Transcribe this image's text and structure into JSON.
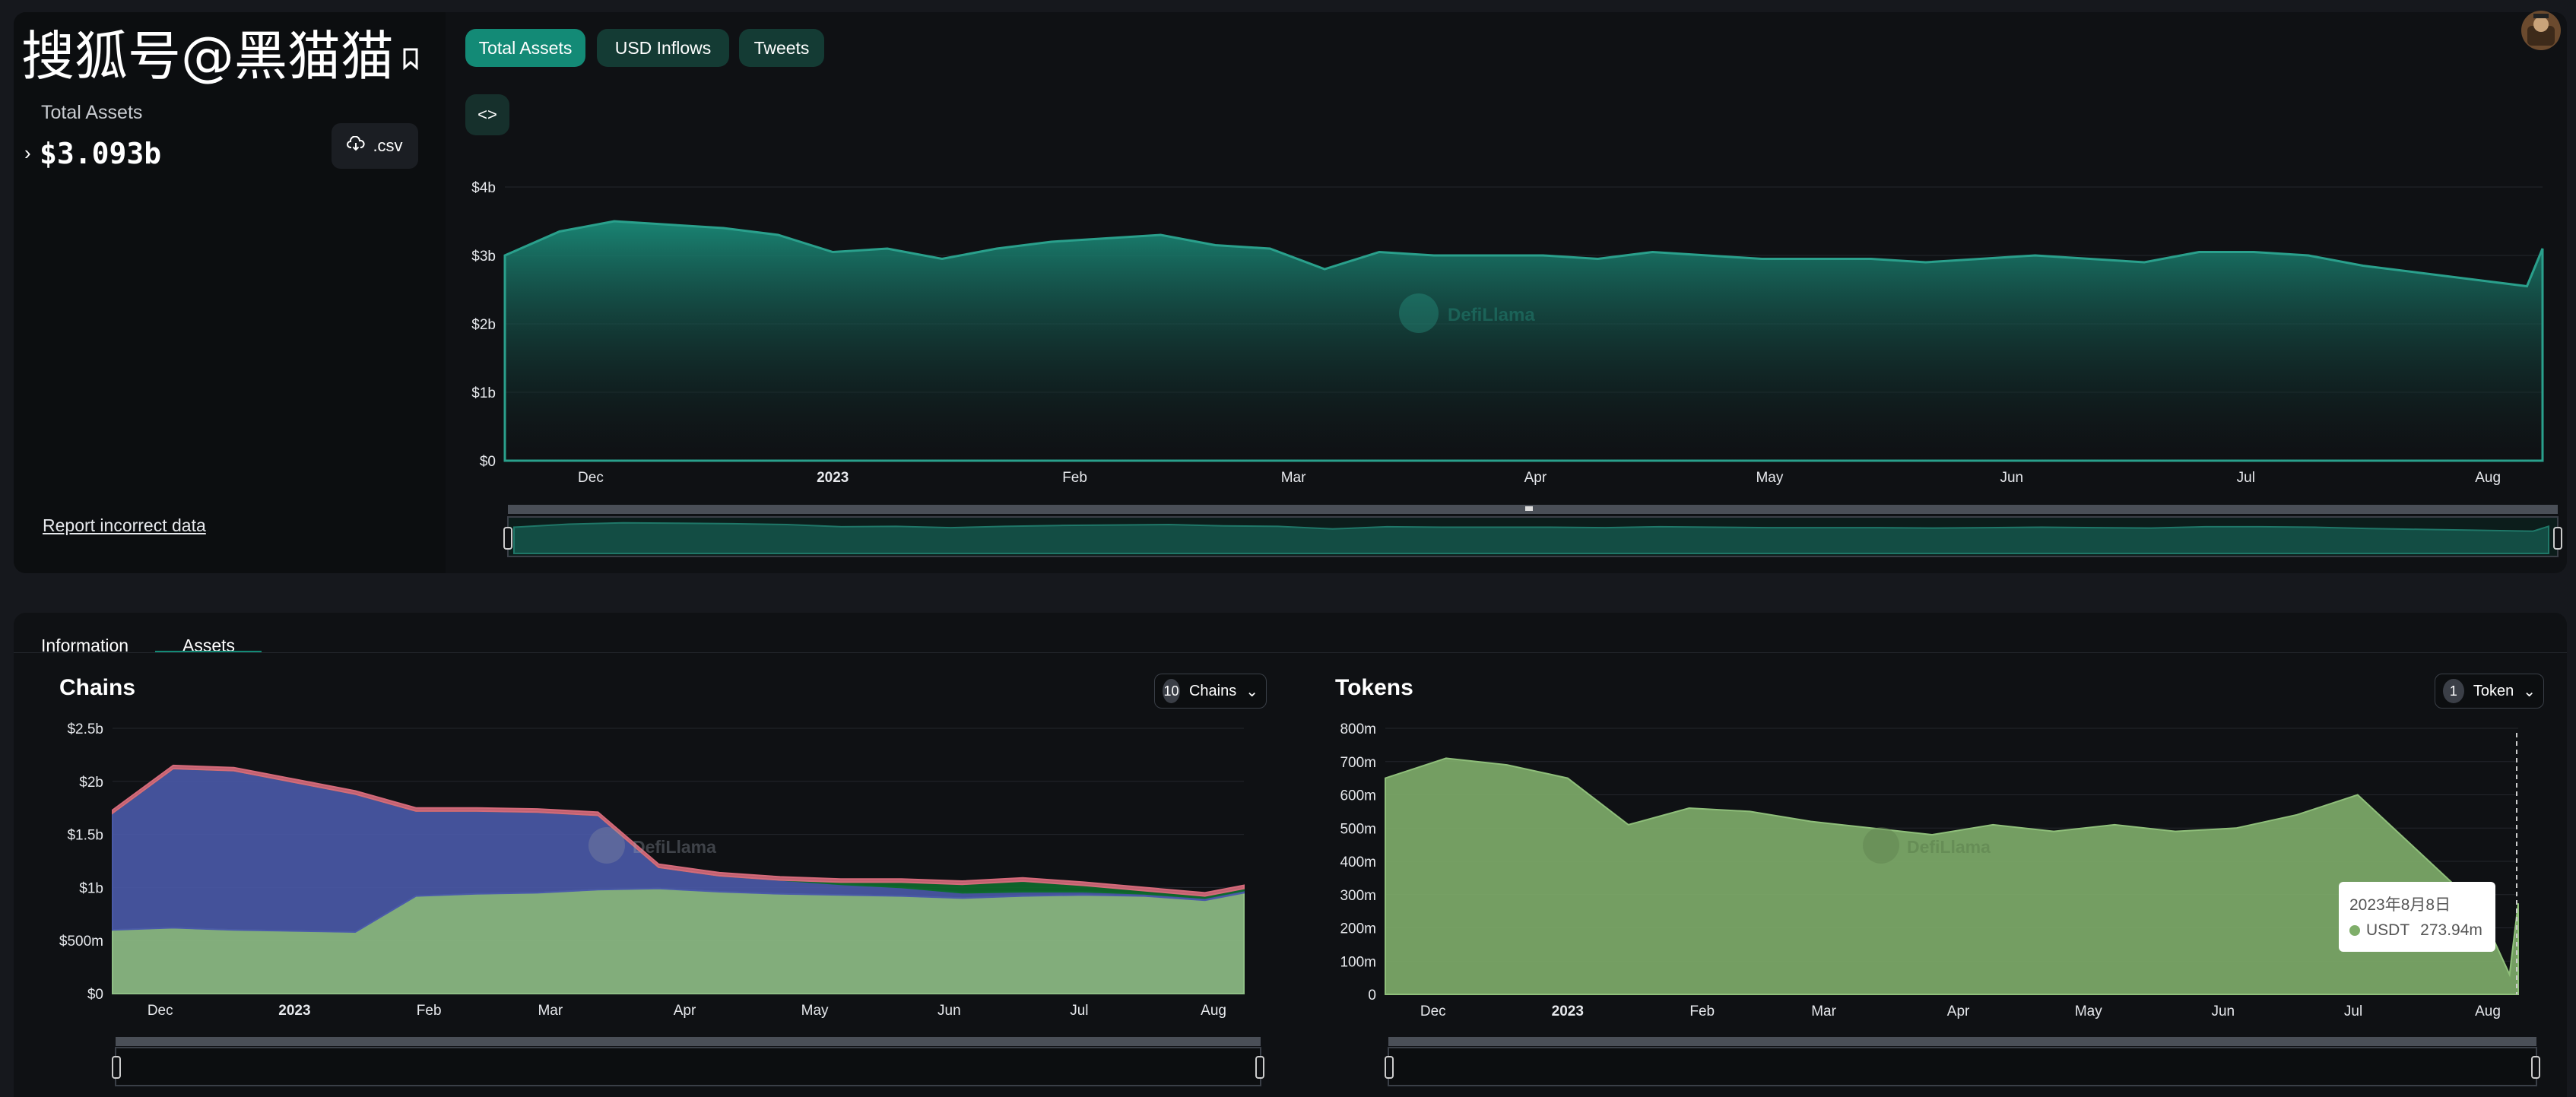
{
  "watermark": "搜狐号@黑猫猫",
  "header": {
    "metric_label": "Total Assets",
    "metric_value": "$3.093b",
    "csv_label": ".csv",
    "report_link": "Report incorrect data"
  },
  "top_tabs": [
    {
      "label": "Total Assets",
      "active": true
    },
    {
      "label": "USD Inflows",
      "active": false
    },
    {
      "label": "Tweets",
      "active": false
    }
  ],
  "brand_watermark": "DefiLlama",
  "bottom_tabs": [
    {
      "label": "Information",
      "active": false
    },
    {
      "label": "Assets",
      "active": true
    }
  ],
  "colors": {
    "accent": "#138a76",
    "total_assets_fill": "#1a8a78",
    "chain_blue": "#4a5aa8",
    "chain_lightgreen": "#8fbf86",
    "chain_darkgreen": "#0e6b2c",
    "token_green": "#7fae6a"
  },
  "icons": [
    "bookmark-icon",
    "cloud-download-icon",
    "chevron-right-icon",
    "code-icon",
    "chevron-down-icon",
    "logo-avatar-icon"
  ],
  "chains_section": {
    "title": "Chains",
    "dropdown_count": "10",
    "dropdown_label": "Chains"
  },
  "tokens_section": {
    "title": "Tokens",
    "dropdown_count": "1",
    "dropdown_label": "Token"
  },
  "tooltip": {
    "date": "2023年8月8日",
    "series": "USDT",
    "value": "273.94m"
  },
  "chart_data": [
    {
      "type": "area",
      "title": "",
      "x_tick_labels": [
        "Dec",
        "2023",
        "Feb",
        "Mar",
        "Apr",
        "May",
        "Jun",
        "Jul",
        "Aug"
      ],
      "y_tick_labels": [
        "$4b",
        "$3b",
        "$2b",
        "$1b",
        "$0"
      ],
      "ylim": [
        0,
        4
      ],
      "y_unit": "b",
      "x": [
        "2022-11-20",
        "2022-11-27",
        "2022-12-04",
        "2022-12-11",
        "2022-12-18",
        "2022-12-25",
        "2023-01-01",
        "2023-01-08",
        "2023-01-15",
        "2023-01-22",
        "2023-01-29",
        "2023-02-05",
        "2023-02-12",
        "2023-02-19",
        "2023-02-26",
        "2023-03-05",
        "2023-03-12",
        "2023-03-19",
        "2023-03-26",
        "2023-04-02",
        "2023-04-09",
        "2023-04-16",
        "2023-04-23",
        "2023-04-30",
        "2023-05-07",
        "2023-05-14",
        "2023-05-21",
        "2023-05-28",
        "2023-06-04",
        "2023-06-11",
        "2023-06-18",
        "2023-06-25",
        "2023-07-02",
        "2023-07-09",
        "2023-07-16",
        "2023-07-23",
        "2023-07-30",
        "2023-08-06",
        "2023-08-08"
      ],
      "series": [
        {
          "values": [
            3.0,
            3.35,
            3.5,
            3.45,
            3.4,
            3.3,
            3.05,
            3.1,
            2.95,
            3.1,
            3.2,
            3.25,
            3.3,
            3.15,
            3.1,
            2.8,
            3.05,
            3.0,
            3.0,
            3.0,
            2.95,
            3.05,
            3.0,
            2.95,
            2.95,
            2.95,
            2.9,
            2.95,
            3.0,
            2.95,
            2.9,
            3.05,
            3.05,
            3.0,
            2.85,
            2.75,
            2.65,
            2.55,
            3.1
          ]
        }
      ]
    },
    {
      "type": "area",
      "title": "Chains",
      "x_tick_labels": [
        "Dec",
        "2023",
        "Feb",
        "Mar",
        "Apr",
        "May",
        "Jun",
        "Jul",
        "Aug"
      ],
      "y_tick_labels": [
        "$2.5b",
        "$2b",
        "$1.5b",
        "$1b",
        "$500m",
        "$0"
      ],
      "ylim": [
        0,
        2500
      ],
      "y_unit": "m",
      "x": [
        "2022-11-20",
        "2022-12-04",
        "2022-12-18",
        "2023-01-01",
        "2023-01-15",
        "2023-01-29",
        "2023-02-12",
        "2023-02-26",
        "2023-03-12",
        "2023-03-26",
        "2023-04-09",
        "2023-04-23",
        "2023-05-07",
        "2023-05-21",
        "2023-06-04",
        "2023-06-18",
        "2023-07-02",
        "2023-07-16",
        "2023-07-30",
        "2023-08-08"
      ],
      "stack": true,
      "series": [
        {
          "values": [
            600,
            620,
            600,
            590,
            580,
            920,
            940,
            950,
            980,
            990,
            960,
            940,
            930,
            920,
            900,
            920,
            930,
            920,
            880,
            950
          ]
        },
        {
          "values": [
            1100,
            1500,
            1500,
            1400,
            1300,
            800,
            780,
            760,
            700,
            200,
            150,
            130,
            100,
            80,
            50,
            40,
            30,
            20,
            20,
            20
          ]
        },
        {
          "values": [
            0,
            0,
            0,
            0,
            0,
            0,
            0,
            0,
            0,
            0,
            0,
            0,
            20,
            50,
            80,
            100,
            60,
            30,
            20,
            20
          ]
        },
        {
          "values": [
            30,
            30,
            30,
            30,
            30,
            30,
            30,
            30,
            30,
            30,
            30,
            30,
            30,
            30,
            30,
            30,
            30,
            30,
            30,
            30
          ]
        }
      ]
    },
    {
      "type": "area",
      "title": "Tokens",
      "x_tick_labels": [
        "Dec",
        "2023",
        "Feb",
        "Mar",
        "Apr",
        "May",
        "Jun",
        "Jul",
        "Aug"
      ],
      "y_tick_labels": [
        "800m",
        "700m",
        "600m",
        "500m",
        "400m",
        "300m",
        "200m",
        "100m",
        "0"
      ],
      "ylim": [
        0,
        800
      ],
      "y_unit": "m",
      "x": [
        "2022-11-20",
        "2022-12-04",
        "2022-12-18",
        "2023-01-01",
        "2023-01-15",
        "2023-01-29",
        "2023-02-12",
        "2023-02-26",
        "2023-03-12",
        "2023-03-26",
        "2023-04-09",
        "2023-04-23",
        "2023-05-07",
        "2023-05-21",
        "2023-06-04",
        "2023-06-18",
        "2023-07-02",
        "2023-07-16",
        "2023-07-30",
        "2023-08-06",
        "2023-08-08"
      ],
      "series": [
        {
          "name": "USDT",
          "values": [
            650,
            710,
            690,
            650,
            510,
            560,
            550,
            520,
            500,
            480,
            510,
            490,
            510,
            490,
            500,
            540,
            600,
            430,
            260,
            60,
            273.94
          ]
        }
      ]
    }
  ]
}
